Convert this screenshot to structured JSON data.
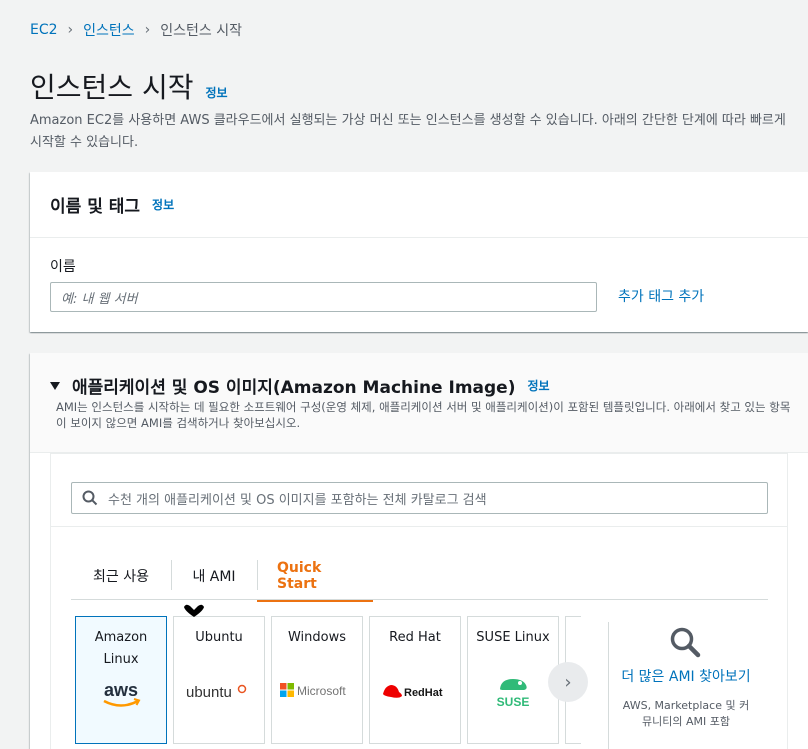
{
  "breadcrumb": {
    "items": [
      "EC2",
      "인스턴스"
    ],
    "current": "인스턴스 시작"
  },
  "page": {
    "title": "인스턴스 시작",
    "info": "정보",
    "description": "Amazon EC2를 사용하면 AWS 클라우드에서 실행되는 가상 머신 또는 인스턴스를 생성할 수 있습니다. 아래의 간단한 단계에 따라 빠르게 시작할 수 있습니다."
  },
  "name_panel": {
    "title": "이름 및 태그",
    "info": "정보",
    "field_label": "이름",
    "placeholder": "예: 내 웹 서버",
    "add_tag": "추가 태그 추가"
  },
  "ami_panel": {
    "title": "애플리케이션 및 OS 이미지(Amazon Machine Image)",
    "info": "정보",
    "description": "AMI는 인스턴스를 시작하는 데 필요한 소프트웨어 구성(운영 체제, 애플리케이션 서버 및 애플리케이션)이 포함된 템플릿입니다. 아래에서 찾고 있는 항목이 보이지 않으면 AMI를 검색하거나 찾아보십시오.",
    "search_placeholder": "수천 개의 애플리케이션 및 OS 이미지를 포함하는 전체 카탈로그 검색",
    "tabs": [
      "최근 사용",
      "내 AMI",
      "Quick Start"
    ],
    "active_tab": "Quick Start",
    "tiles": [
      {
        "name_line1": "Amazon",
        "name_line2": "Linux",
        "logo_text": "aws",
        "selected": true
      },
      {
        "name_line1": "Ubuntu",
        "name_line2": "",
        "logo_text": "ubuntu",
        "selected": false
      },
      {
        "name_line1": "Windows",
        "name_line2": "",
        "logo_text": "Microsoft",
        "selected": false
      },
      {
        "name_line1": "Red Hat",
        "name_line2": "",
        "logo_text": "Red Hat",
        "selected": false
      },
      {
        "name_line1": "SUSE Linux",
        "name_line2": "",
        "logo_text": "SUSE",
        "selected": false
      }
    ],
    "more": {
      "title": "더 많은 AMI 찾아보기",
      "subtitle": "AWS, Marketplace 및 커뮤니티의 AMI 포함"
    }
  },
  "colors": {
    "link": "#0073bb",
    "accent": "#ec7211",
    "aws_orange": "#ff9900",
    "redhat_red": "#ee0000",
    "suse_green": "#30ba78",
    "ubuntu_orange": "#e95420"
  }
}
